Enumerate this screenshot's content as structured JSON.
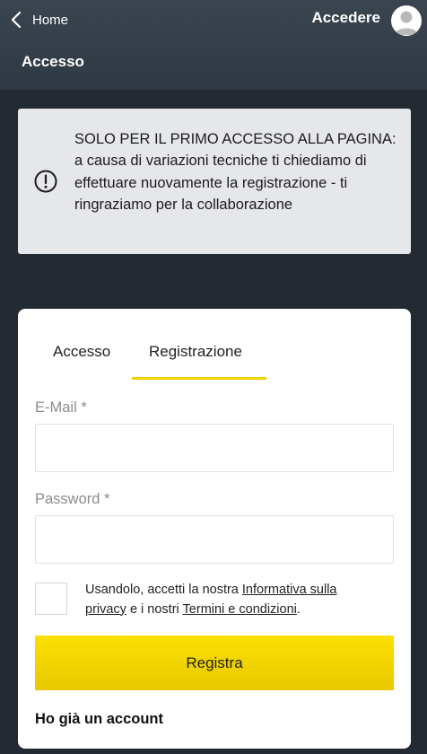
{
  "header": {
    "back_label": "Home",
    "login_link": "Accedere",
    "page_title": "Accesso"
  },
  "notice": {
    "icon": "alert-circle-icon",
    "text": "SOLO PER IL PRIMO ACCESSO ALLA PAGINA: a causa di variazioni tecniche ti chiediamo di effettuare nuovamente la registrazione - ti ringraziamo per la collaborazione"
  },
  "tabs": [
    {
      "label": "Accesso",
      "active": false
    },
    {
      "label": "Registrazione",
      "active": true
    }
  ],
  "form": {
    "email_label": "E-Mail *",
    "email_value": "",
    "password_label": "Password *",
    "password_value": "",
    "consent": {
      "prefix": "Usandolo, accetti la nostra ",
      "privacy_link": "Informativa sulla privacy",
      "middle": " e i nostri ",
      "terms_link": "Termini e condizioni",
      "suffix": "."
    },
    "submit_label": "Registra",
    "have_account": "Ho già un account"
  },
  "colors": {
    "accent_yellow": "#f2d100",
    "header_bg": "#36414c",
    "page_bg": "#232a32",
    "notice_bg": "#e6e7ea"
  }
}
